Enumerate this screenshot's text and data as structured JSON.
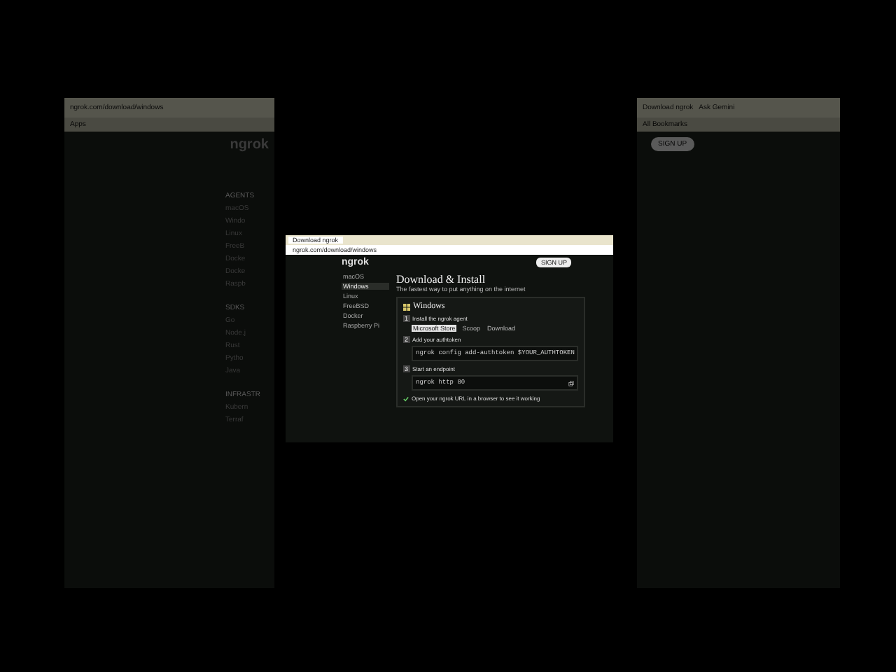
{
  "background_left": {
    "url": "ngrok.com/download/windows",
    "bookmark": "Apps",
    "logo": "ngrok",
    "sections": [
      {
        "heading": "AGENTS",
        "items": [
          "macOS",
          "Windo",
          "Linux",
          "FreeB",
          "Docke",
          "Docke",
          "Raspb"
        ]
      },
      {
        "heading": "SDKS",
        "items": [
          "Go",
          "Node.j",
          "Rust",
          "Pytho",
          "Java"
        ]
      },
      {
        "heading": "INFRASTR",
        "items": [
          "Kubern",
          "Terraf"
        ]
      }
    ]
  },
  "background_right": {
    "tab": "Download ngrok",
    "assistant": "Ask Gemini",
    "bookmarks": "All Bookmarks",
    "signup": "SIGN UP"
  },
  "window": {
    "tab": "Download ngrok",
    "url": "ngrok.com/download/windows",
    "logo": "ngrok",
    "signup": "SIGN UP",
    "sidebar": [
      {
        "label": "macOS",
        "selected": false
      },
      {
        "label": "Windows",
        "selected": true
      },
      {
        "label": "Linux",
        "selected": false
      },
      {
        "label": "FreeBSD",
        "selected": false
      },
      {
        "label": "Docker",
        "selected": false
      },
      {
        "label": "Raspberry Pi",
        "selected": false
      }
    ],
    "title": "Download & Install",
    "subtitle": "The fastest way to put anything on the internet",
    "platform": "Windows",
    "steps": [
      {
        "number": "1",
        "title": "Install the ngrok agent",
        "tabs": [
          {
            "label": "Microsoft Store",
            "selected": true
          },
          {
            "label": "Scoop",
            "selected": false
          },
          {
            "label": "Download",
            "selected": false
          }
        ]
      },
      {
        "number": "2",
        "title": "Add your authtoken",
        "command": "ngrok config add-authtoken $YOUR_AUTHTOKEN"
      },
      {
        "number": "3",
        "title": "Start an endpoint",
        "command": "ngrok http 80"
      }
    ],
    "final": "Open your ngrok URL in a browser to see it working"
  }
}
